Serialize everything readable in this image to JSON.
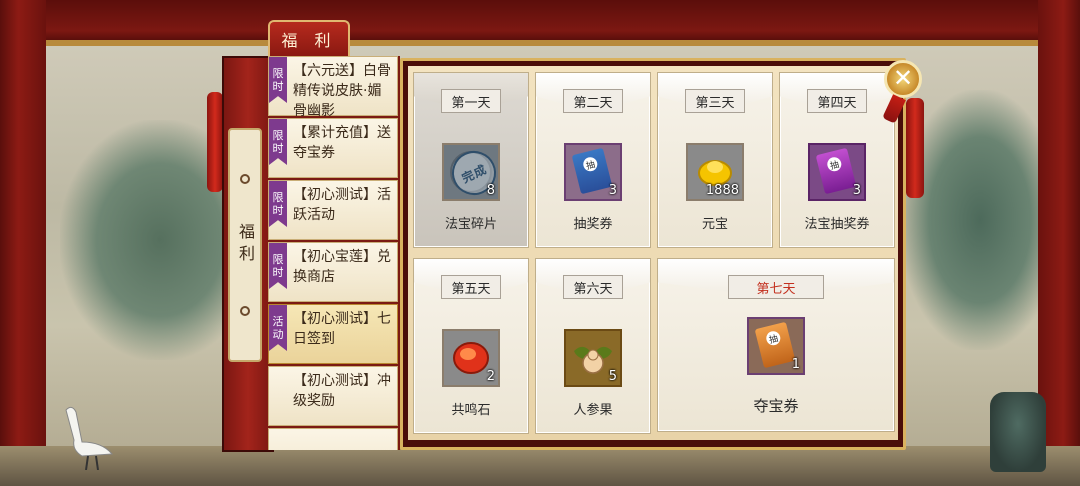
{
  "header": {
    "title": "福 利"
  },
  "side_tab": {
    "label": "福利"
  },
  "events": [
    {
      "badge": "限时",
      "text": "【六元送】白骨精传说皮肤·媚骨幽影"
    },
    {
      "badge": "限时",
      "text": "【累计充值】送夺宝券"
    },
    {
      "badge": "限时",
      "text": "【初心测试】活跃活动"
    },
    {
      "badge": "限时",
      "text": "【初心宝莲】兑换商店"
    },
    {
      "badge": "活动",
      "text": "【初心测试】七日签到"
    },
    {
      "badge": "",
      "text": "【初心测试】冲级奖励"
    }
  ],
  "signin": {
    "days": [
      {
        "day": "第一天",
        "name": "法宝碎片",
        "qty": "8",
        "icon": "treasure-shard-icon",
        "status": "完成"
      },
      {
        "day": "第二天",
        "name": "抽奖券",
        "qty": "3",
        "icon": "lottery-ticket-icon"
      },
      {
        "day": "第三天",
        "name": "元宝",
        "qty": "1888",
        "icon": "gold-ingot-icon"
      },
      {
        "day": "第四天",
        "name": "法宝抽奖券",
        "qty": "3",
        "icon": "treasure-lottery-ticket-icon"
      },
      {
        "day": "第五天",
        "name": "共鸣石",
        "qty": "2",
        "icon": "resonance-stone-icon"
      },
      {
        "day": "第六天",
        "name": "人参果",
        "qty": "5",
        "icon": "ginseng-fruit-icon"
      },
      {
        "day": "第七天",
        "name": "夺宝券",
        "qty": "1",
        "icon": "treasure-hunt-ticket-icon"
      }
    ]
  },
  "close_button": {
    "icon": "close-icon",
    "glyph": "✕"
  },
  "colors": {
    "accent_red": "#8a1911",
    "gold_trim": "#d9b25f",
    "badge_purple": "#7e3a8e"
  }
}
